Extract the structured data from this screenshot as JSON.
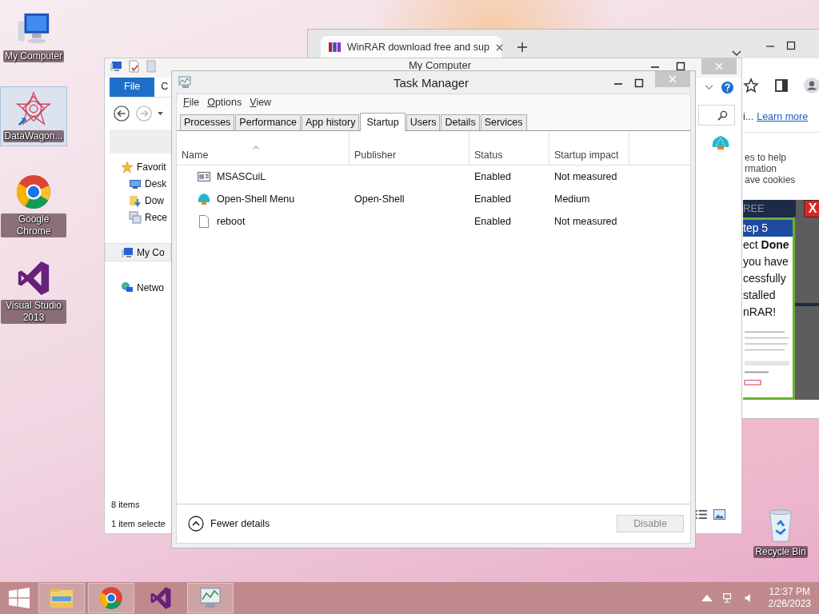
{
  "desktop_icons": [
    {
      "label": "My Computer",
      "kind": "computer",
      "selected": false
    },
    {
      "label": "DataWagon...",
      "kind": "mandala",
      "selected": true
    },
    {
      "label": "Google Chrome",
      "kind": "chrome",
      "selected": false
    },
    {
      "label": "Visual Studio 2013",
      "kind": "vs",
      "selected": false
    }
  ],
  "recycle_bin": {
    "label": "Recycle Bin"
  },
  "browser": {
    "tab_title": "WinRAR download free and sup",
    "page_prefix": "i...",
    "link": "Learn more",
    "cookie_lines": [
      "es to help",
      "rmation",
      "ave cookies"
    ],
    "ad": {
      "banner": "REE",
      "close": "X",
      "step": "tep 5",
      "lines": [
        "ect **Done**",
        "you have",
        "cessfully",
        "stalled",
        "nRAR!"
      ]
    }
  },
  "explorer": {
    "title": "My Computer",
    "ribbon_tabs": [
      {
        "label": "File",
        "selected": true
      },
      {
        "label": "C",
        "selected": false
      }
    ],
    "nav_items": [
      {
        "label": "Favorit",
        "kind": "star",
        "selected": false,
        "children": [
          {
            "label": "Desk",
            "kind": "desktop",
            "selected": false
          },
          {
            "label": "Dow",
            "kind": "download",
            "selected": false
          },
          {
            "label": "Rece",
            "kind": "recent",
            "selected": false
          }
        ]
      },
      {
        "label": "My Co",
        "kind": "computer",
        "selected": true
      },
      {
        "label": "Netwo",
        "kind": "network",
        "selected": false
      }
    ],
    "status": {
      "count": "8 items",
      "selection": "1 item selecte"
    }
  },
  "task_manager": {
    "title": "Task Manager",
    "menu": [
      "File",
      "Options",
      "View"
    ],
    "tabs": [
      {
        "label": "Processes",
        "selected": false
      },
      {
        "label": "Performance",
        "selected": false
      },
      {
        "label": "App history",
        "selected": false
      },
      {
        "label": "Startup",
        "selected": true
      },
      {
        "label": "Users",
        "selected": false
      },
      {
        "label": "Details",
        "selected": false
      },
      {
        "label": "Services",
        "selected": false
      }
    ],
    "columns": [
      "Name",
      "Publisher",
      "Status",
      "Startup impact"
    ],
    "rows": [
      {
        "kind": "window",
        "name": "MSASCuiL",
        "status": "Enabled",
        "impact": "Not measured"
      },
      {
        "kind": "shell",
        "name": "Open-Shell Menu",
        "publisher": "Open-Shell",
        "status": "Enabled",
        "impact": "Medium"
      },
      {
        "kind": "file",
        "name": "reboot",
        "status": "Enabled",
        "impact": "Not measured"
      }
    ],
    "footer": {
      "toggle": "Fewer details",
      "button": {
        "label": "Disable",
        "disabled": true
      }
    }
  },
  "taskbar": {
    "apps": [
      {
        "kind": "explorer",
        "running": true
      },
      {
        "kind": "chrome",
        "running": true
      },
      {
        "kind": "vs",
        "running": false
      },
      {
        "kind": "taskmgr",
        "running": true
      }
    ],
    "time": "12:37 PM",
    "date": "2/26/2023"
  }
}
